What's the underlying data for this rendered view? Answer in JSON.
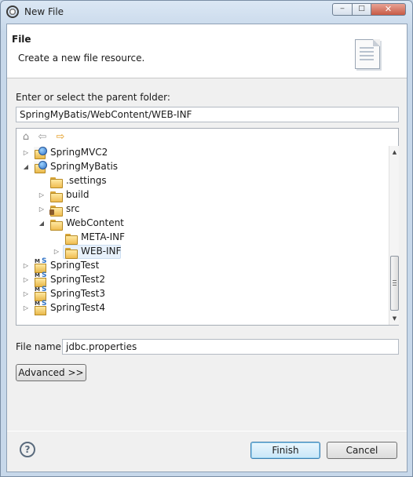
{
  "window": {
    "title": "New File",
    "controls": {
      "min": "‒",
      "max": "□",
      "close": "✕"
    }
  },
  "banner": {
    "title": "File",
    "description": "Create a new file resource."
  },
  "parent_folder": {
    "label": "Enter or select the parent folder:",
    "value": "SpringMyBatis/WebContent/WEB-INF"
  },
  "tree": {
    "toolbar": {
      "home": "⌂",
      "back": "⇦",
      "forward": "⇨"
    },
    "items": [
      {
        "label": "SpringMVC2",
        "icon": "project-icon",
        "expanded": false
      },
      {
        "label": "SpringMyBatis",
        "icon": "project-icon",
        "expanded": true
      },
      {
        "label": ".settings",
        "icon": "folder-icon"
      },
      {
        "label": "build",
        "icon": "folder-icon",
        "expanded": false
      },
      {
        "label": "src",
        "icon": "source-folder-icon",
        "expanded": false
      },
      {
        "label": "WebContent",
        "icon": "folder-icon",
        "expanded": true
      },
      {
        "label": "META-INF",
        "icon": "folder-icon"
      },
      {
        "label": "WEB-INF",
        "icon": "folder-icon",
        "expanded": false,
        "selected": true
      },
      {
        "label": "SpringTest",
        "icon": "maven-project-icon",
        "expanded": false
      },
      {
        "label": "SpringTest2",
        "icon": "maven-project-icon",
        "expanded": false
      },
      {
        "label": "SpringTest3",
        "icon": "maven-project-icon",
        "expanded": false
      },
      {
        "label": "SpringTest4",
        "icon": "maven-project-icon",
        "expanded": false
      }
    ],
    "maven_badge": {
      "prefix": "M",
      "suffix": "S"
    },
    "scroll": {
      "up": "▲",
      "down": "▼"
    }
  },
  "file_name": {
    "label": "File name:",
    "value": "jdbc.properties"
  },
  "buttons": {
    "advanced": "Advanced >>",
    "finish": "Finish",
    "cancel": "Cancel",
    "help": "?"
  },
  "arrows": {
    "collapsed": "▷",
    "expanded": "◢"
  }
}
